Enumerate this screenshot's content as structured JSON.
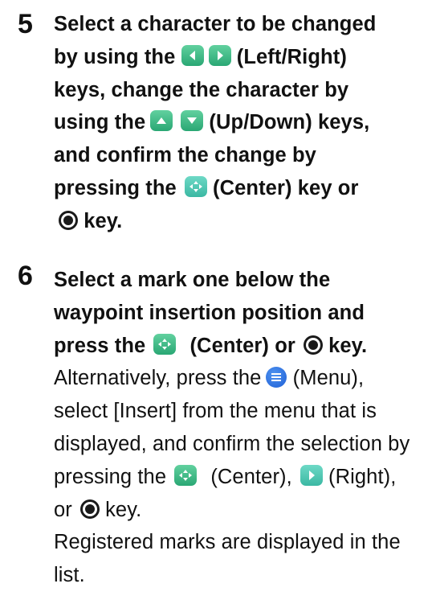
{
  "step5": {
    "number": "5",
    "lines": {
      "l1": "Select a character to be changed",
      "l2_a": "by using the",
      "l2_b": "(Left/Right)",
      "l3": "keys, change the character by",
      "l4_a": "using the",
      "l4_b": "(Up/Down) keys,",
      "l5": "and confirm the change by",
      "l6_a": "pressing the",
      "l6_b": "(Center) key or",
      "l7_b": "key."
    }
  },
  "step6": {
    "number": "6",
    "lines": {
      "l1": "Select a mark one below the",
      "l2": "waypoint insertion position and",
      "l3_a": "press the",
      "l3_b": "(Center) or",
      "l3_c": "key.",
      "l4_a": "Alternatively, press the",
      "l4_b": "(Menu),",
      "l5": "select [Insert] from the menu that is",
      "l6": "displayed, and confirm the selection by",
      "l7_a": "pressing the",
      "l7_b": "(Center),",
      "l7_c": "(Right),",
      "l8_a": "or",
      "l8_b": "key.",
      "l9": "Registered marks are displayed in the",
      "l10": "list."
    }
  },
  "icons": {
    "left_key": "left-arrow-key-icon",
    "right_key": "right-arrow-key-icon",
    "up_key": "up-arrow-key-icon",
    "down_key": "down-arrow-key-icon",
    "center_key": "center-key-icon",
    "enter_key": "enter-button-icon",
    "menu_key": "menu-key-icon"
  },
  "colors": {
    "text": "#111111",
    "key_green": "#34b586",
    "menu_blue": "#2a6fe0"
  }
}
